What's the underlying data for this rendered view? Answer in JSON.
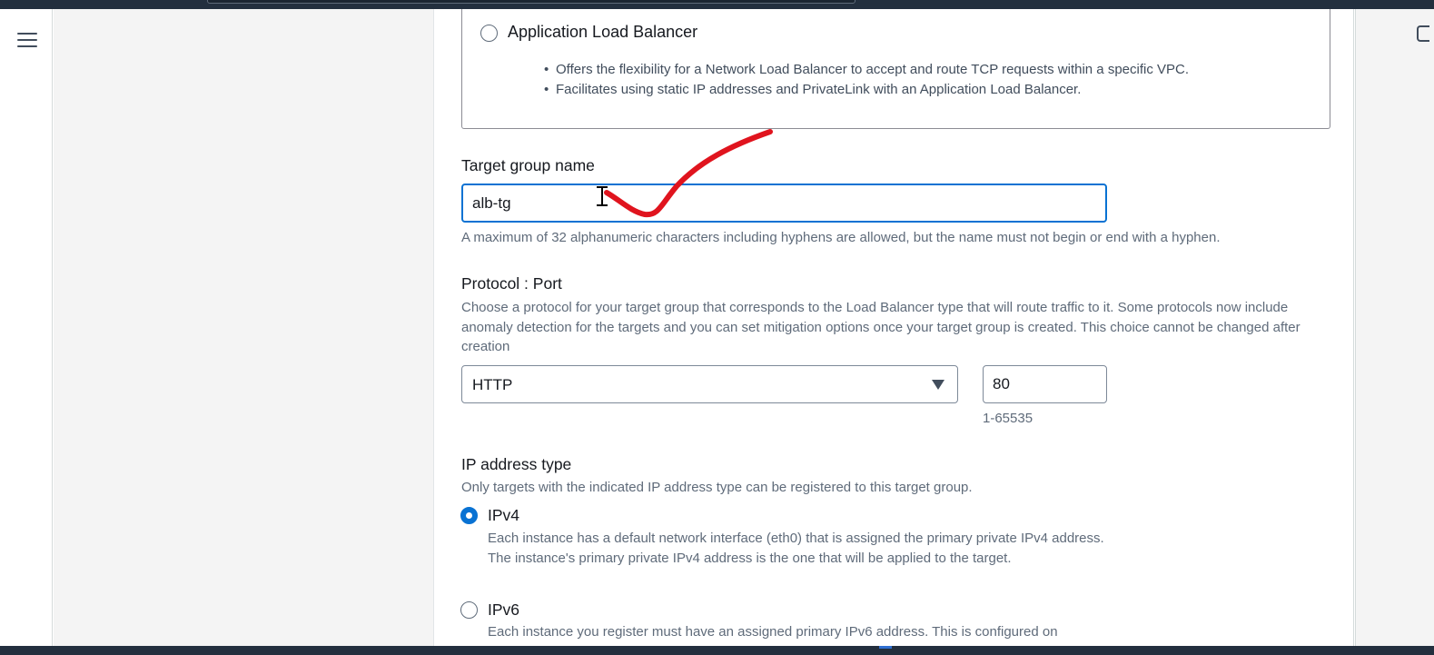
{
  "load_balancer_option": {
    "label": "Application Load Balancer",
    "selected": false,
    "bullets": [
      "Offers the flexibility for a Network Load Balancer to accept and route TCP requests within a specific VPC.",
      "Facilitates using static IP addresses and PrivateLink with an Application Load Balancer."
    ]
  },
  "target_group_name": {
    "label": "Target group name",
    "value": "alb-tg",
    "hint": "A maximum of 32 alphanumeric characters including hyphens are allowed, but the name must not begin or end with a hyphen."
  },
  "protocol_port": {
    "label": "Protocol : Port",
    "description": "Choose a protocol for your target group that corresponds to the Load Balancer type that will route traffic to it. Some protocols now include anomaly detection for the targets and you can set mitigation options once your target group is created. This choice cannot be changed after creation",
    "protocol_value": "HTTP",
    "port_value": "80",
    "port_hint": "1-65535"
  },
  "ip_address_type": {
    "label": "IP address type",
    "description": "Only targets with the indicated IP address type can be registered to this target group.",
    "options": [
      {
        "label": "IPv4",
        "selected": true,
        "description": "Each instance has a default network interface (eth0) that is assigned the primary private IPv4 address. The instance's primary private IPv4 address is the one that will be applied to the target."
      },
      {
        "label": "IPv6",
        "selected": false,
        "description": "Each instance you register must have an assigned primary IPv6 address. This is configured on"
      }
    ]
  },
  "icons": {
    "menu": "hamburger-menu-icon",
    "dropdown": "caret-down-icon",
    "cursor": "text-cursor-icon",
    "annotation": "red-checkmark-annotation"
  },
  "colors": {
    "accent": "#0972d3",
    "annotation": "#e0141e",
    "top_bar": "#232f3e"
  }
}
